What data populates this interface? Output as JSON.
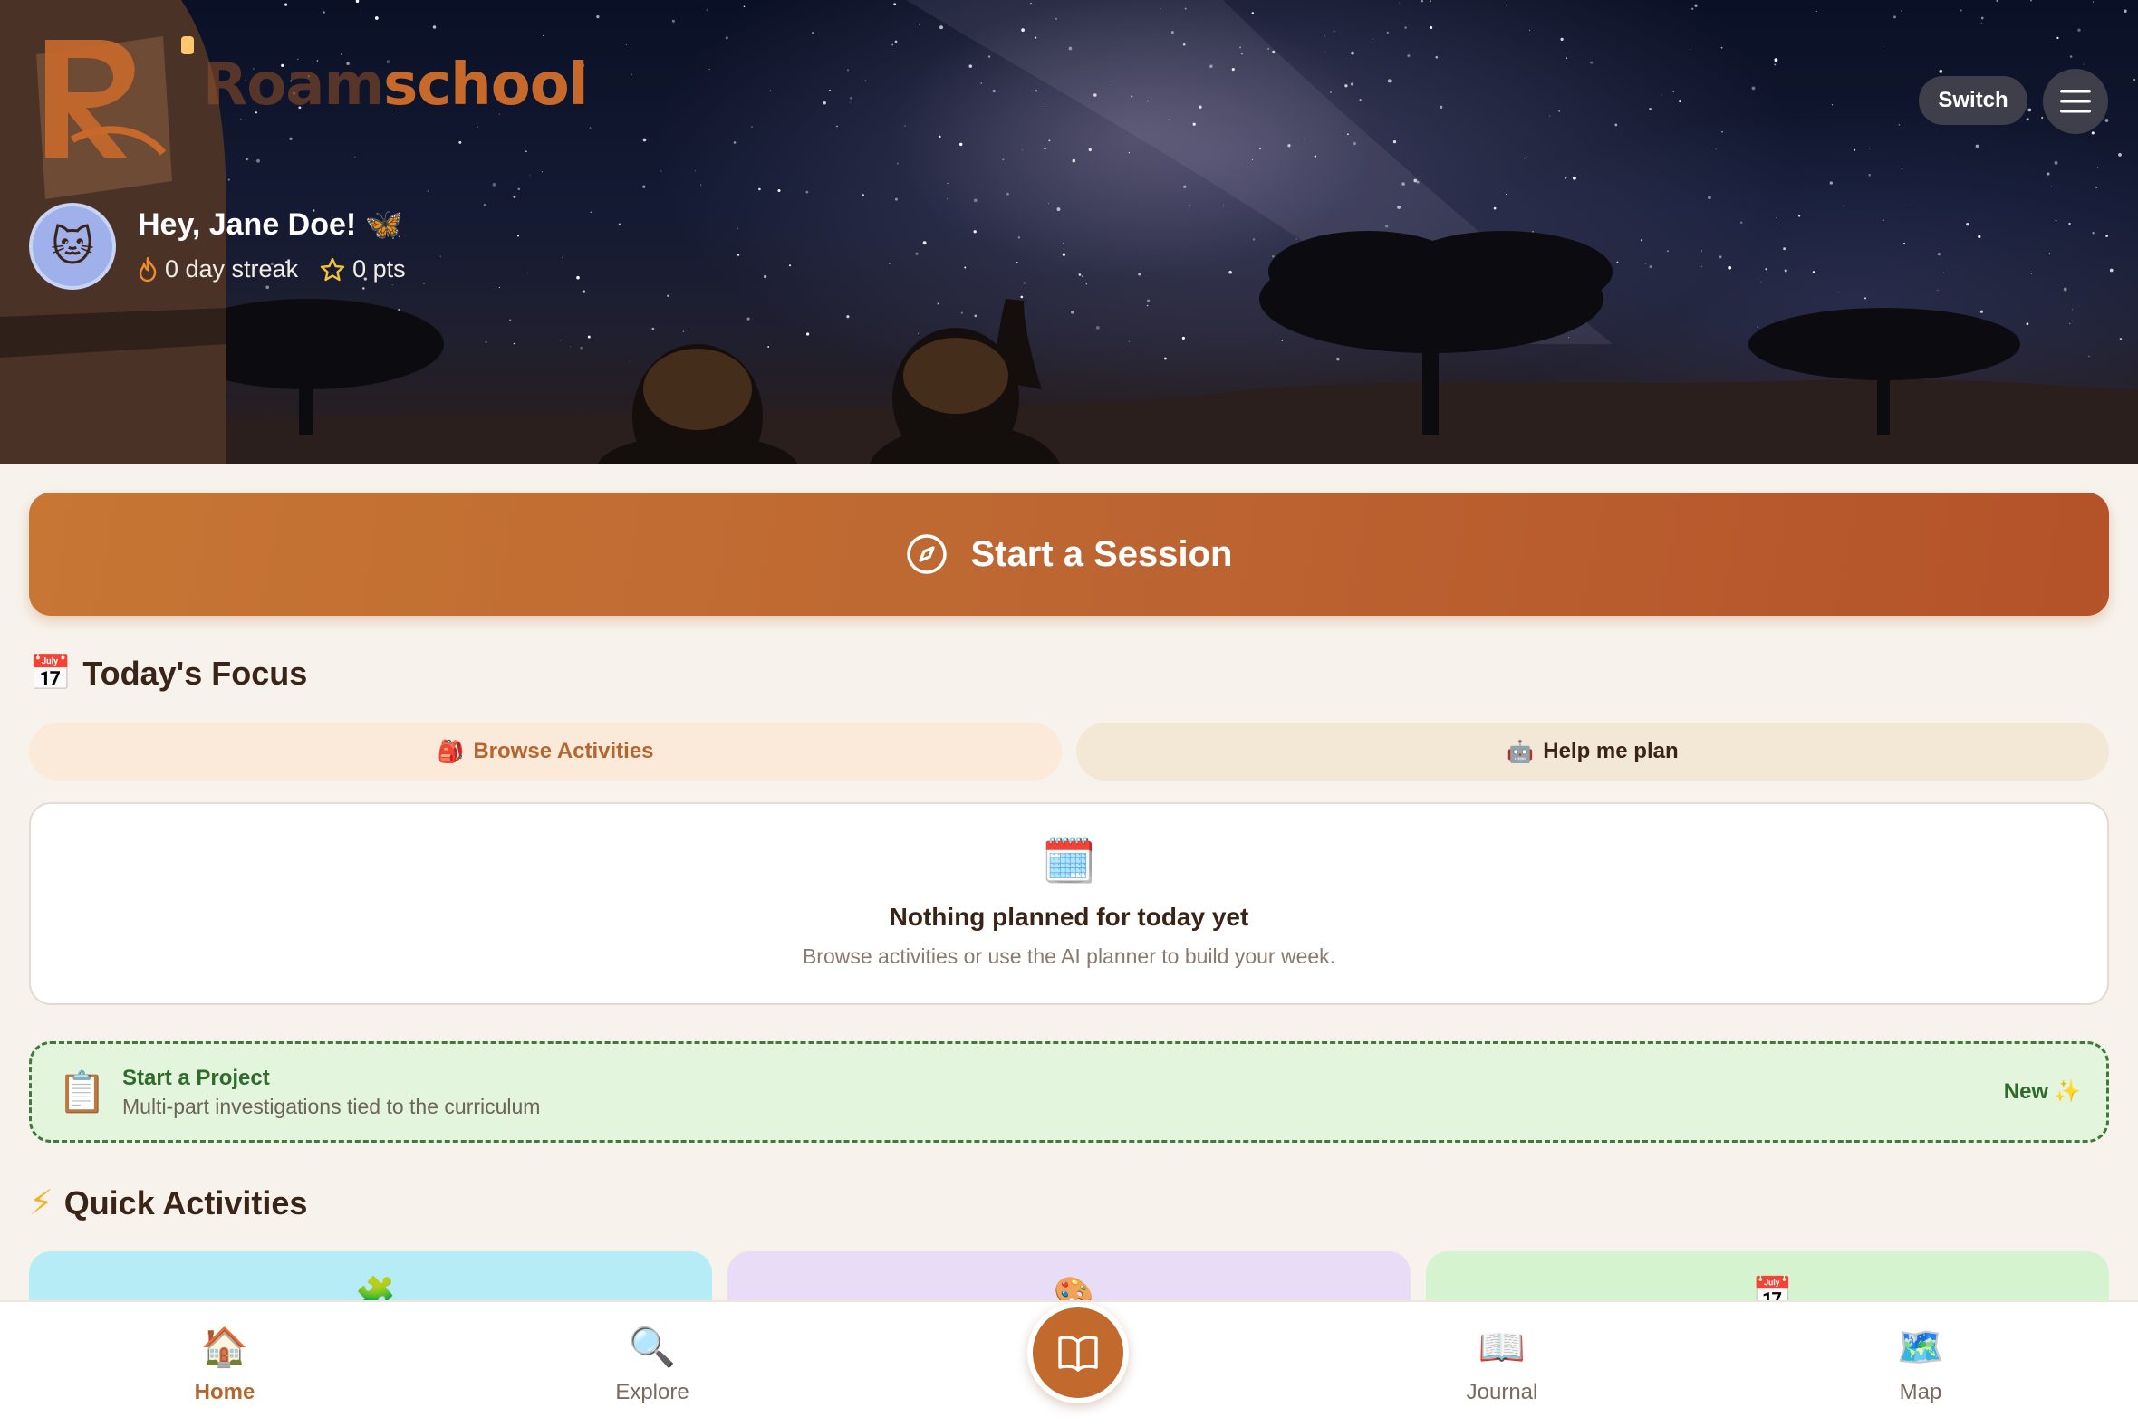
{
  "app": {
    "name": "Roamschool",
    "name_faded": "Roam",
    "name_strong": "school"
  },
  "header": {
    "switch_label": "Switch",
    "greeting": "Hey, Jane Doe! 🦋",
    "avatar_emoji": "🐱",
    "streak": "0 day streak",
    "points": "0 pts"
  },
  "session": {
    "label": "Start a Session"
  },
  "focus": {
    "title": "Today's Focus",
    "emoji": "📅",
    "browse_label": "Browse Activities",
    "browse_emoji": "🎒",
    "plan_label": "Help me plan",
    "plan_emoji": "🤖",
    "empty_emoji": "🗓️",
    "empty_title": "Nothing planned for today yet",
    "empty_sub": "Browse activities or use the AI planner to build your week."
  },
  "project": {
    "emoji": "📋",
    "title": "Start a Project",
    "sub": "Multi-part investigations tied to the curriculum",
    "badge": "New",
    "badge_emoji": "✨"
  },
  "quick": {
    "title": "Quick Activities",
    "emoji": "⚡",
    "cards": [
      {
        "emoji": "🧩",
        "color": "#b6ecf6"
      },
      {
        "emoji": "🎨",
        "color": "#e8dcf6"
      },
      {
        "emoji": "📅",
        "color": "#d6f3cf"
      }
    ]
  },
  "nav": {
    "items": [
      {
        "label": "Home",
        "emoji": "🏠",
        "active": true
      },
      {
        "label": "Explore",
        "emoji": "🔍",
        "active": false
      },
      {
        "label": "Journal",
        "emoji": "📖",
        "active": false
      },
      {
        "label": "Map",
        "emoji": "🗺️",
        "active": false
      }
    ]
  },
  "colors": {
    "accent": "#c26a2e",
    "project_green": "#2e6b2c",
    "background": "#f7f3ec"
  }
}
